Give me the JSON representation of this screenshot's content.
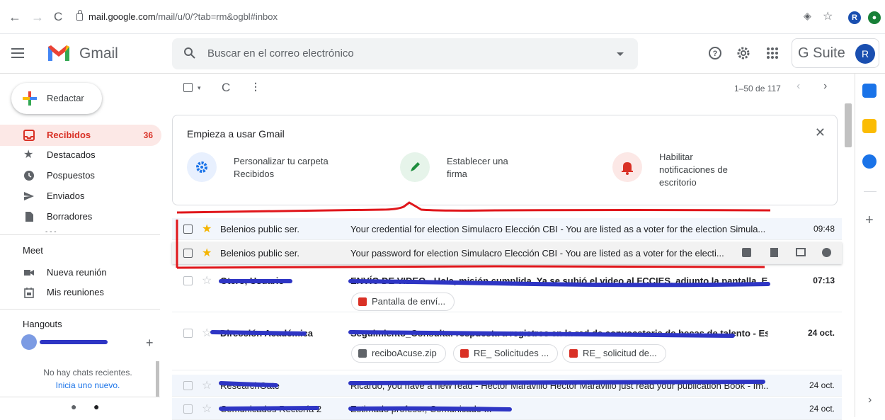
{
  "browser": {
    "url_host": "mail.google.com",
    "url_path": "/mail/u/0/?tab=rm&ogbl#inbox"
  },
  "header": {
    "app_name": "Gmail",
    "search_placeholder": "Buscar en el correo electrónico",
    "gsuite_label": "G Suite",
    "avatar_letter": "R"
  },
  "sidebar": {
    "compose_label": "Redactar",
    "items": [
      {
        "label": "Recibidos",
        "count": "36",
        "icon": "inbox-icon",
        "active": true
      },
      {
        "label": "Destacados",
        "count": "",
        "icon": "star-icon"
      },
      {
        "label": "Pospuestos",
        "count": "",
        "icon": "clock-icon"
      },
      {
        "label": "Enviados",
        "count": "",
        "icon": "send-icon"
      },
      {
        "label": "Borradores",
        "count": "",
        "icon": "draft-icon"
      }
    ],
    "meet": {
      "title": "Meet",
      "new_meeting": "Nueva reunión",
      "my_meetings": "Mis reuniones"
    },
    "hangouts": {
      "title": "Hangouts",
      "no_chats": "No hay chats recientes.",
      "start_new": "Inicia uno nuevo."
    }
  },
  "toolbar": {
    "pager": "1–50 de 117"
  },
  "onboarding": {
    "title": "Empieza a usar Gmail",
    "items": [
      {
        "text": "Personalizar tu carpeta Recibidos",
        "icon": "gear-icon",
        "color": "#1a73e8"
      },
      {
        "text": "Establecer una firma",
        "icon": "pen-icon",
        "color": "#1e8e3e"
      },
      {
        "text": "Habilitar notificaciones de escritorio",
        "icon": "bell-icon",
        "color": "#d93025"
      }
    ]
  },
  "emails": [
    {
      "sender": "Belenios public ser.",
      "subject": "Your credential for election Simulacro Elección CBI - You are listed as a voter for the election Simula...",
      "time": "09:48",
      "starred": true,
      "read": true
    },
    {
      "sender": "Belenios public ser.",
      "subject": "Your password for election Simulacro Elección CBI - You are listed as a voter for the electi...",
      "time": "",
      "starred": true,
      "read": true,
      "hovered": true
    },
    {
      "sender": "Otero, Usuario",
      "subject": "ENVÍO DE VIDEO - Hola, misión cumplida. Ya se subió el video al FCCIES, adjunto la pantalla. Espere...",
      "time": "07:13",
      "starred": false,
      "read": false,
      "attachments": [
        "Pantalla de enví..."
      ]
    },
    {
      "sender": "Dirección Académica",
      "subject": "Seguimiento_Consulta: respuesta a registros en la red de convocatoria de becas de talento - Estim...",
      "time": "24 oct.",
      "starred": false,
      "read": false,
      "attachments": [
        "reciboAcuse.zip",
        "RE_ Solicitudes ...",
        "RE_ solicitud de..."
      ]
    },
    {
      "sender": "ResearchGate",
      "subject": "Ricardo, you have a new read - Hector Maravillo Hector Maravillo just read your publication Book - Im...",
      "time": "24 oct.",
      "starred": false,
      "read": true
    },
    {
      "sender": "Comunicados Rectoría 2",
      "subject": "Estimado profesor, Comunicado ...",
      "time": "24 oct.",
      "starred": false,
      "read": true
    }
  ],
  "colors": {
    "accent_red": "#d93025",
    "redaction_blue": "#2e35c4",
    "annotation_red": "#e0161b"
  }
}
